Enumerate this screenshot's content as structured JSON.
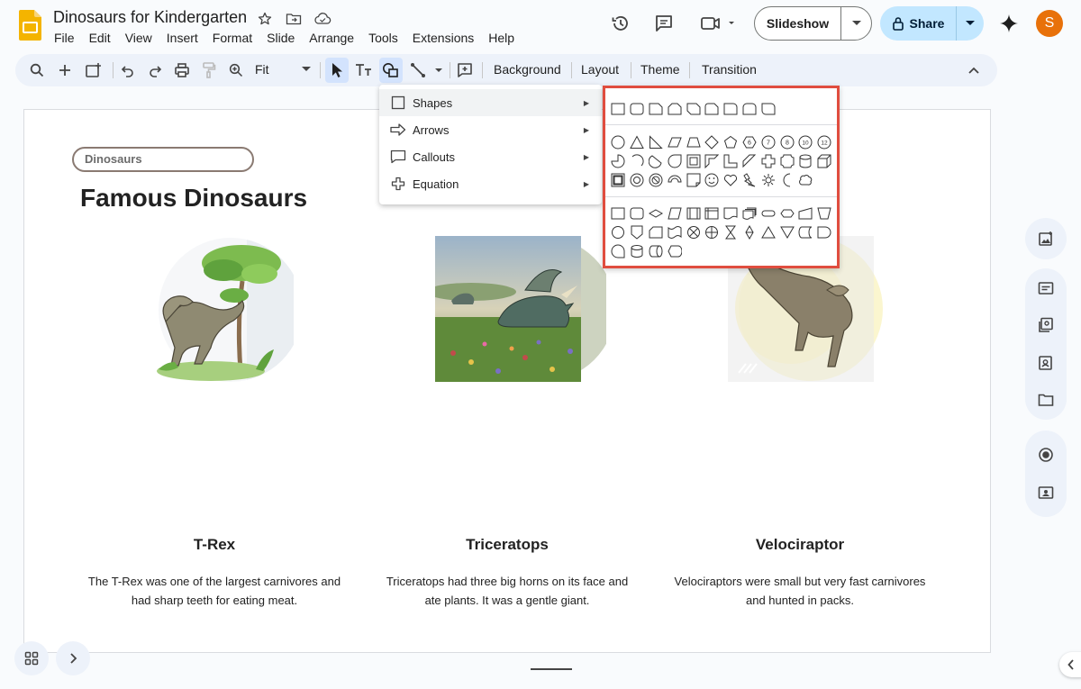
{
  "header": {
    "doc_title": "Dinosaurs for Kindergarten",
    "menus": [
      "File",
      "Edit",
      "View",
      "Insert",
      "Format",
      "Slide",
      "Arrange",
      "Tools",
      "Extensions",
      "Help"
    ],
    "slideshow_label": "Slideshow",
    "share_label": "Share",
    "avatar_letter": "S",
    "accent_color": "#c2e7ff",
    "avatar_color": "#e8710a"
  },
  "toolbar": {
    "zoom": "Fit",
    "background_label": "Background",
    "layout_label": "Layout",
    "theme_label": "Theme",
    "transition_label": "Transition"
  },
  "insert_menu": {
    "items": [
      {
        "label": "Shapes",
        "icon": "square-icon"
      },
      {
        "label": "Arrows",
        "icon": "arrow-icon"
      },
      {
        "label": "Callouts",
        "icon": "speech-bubble-icon"
      },
      {
        "label": "Equation",
        "icon": "plus-icon"
      }
    ],
    "highlight_color": "#e04d3f"
  },
  "slide": {
    "tag": "Dinosaurs",
    "title": "Famous Dinosaurs",
    "cards": [
      {
        "name": "T-Rex",
        "desc_line1": "The T-Rex was one of the largest carnivores and",
        "desc_line2": "had sharp teeth for eating meat.",
        "image": "t-rex-illustration"
      },
      {
        "name": "Triceratops",
        "desc_line1": "Triceratops had three big horns on its face and",
        "desc_line2": "ate plants. It was a gentle giant.",
        "image": "triceratops-photo"
      },
      {
        "name": "Velociraptor",
        "desc_line1": "Velociraptors were small but very fast carnivores",
        "desc_line2": "and hunted in packs.",
        "image": "velociraptor-illustration"
      }
    ]
  }
}
